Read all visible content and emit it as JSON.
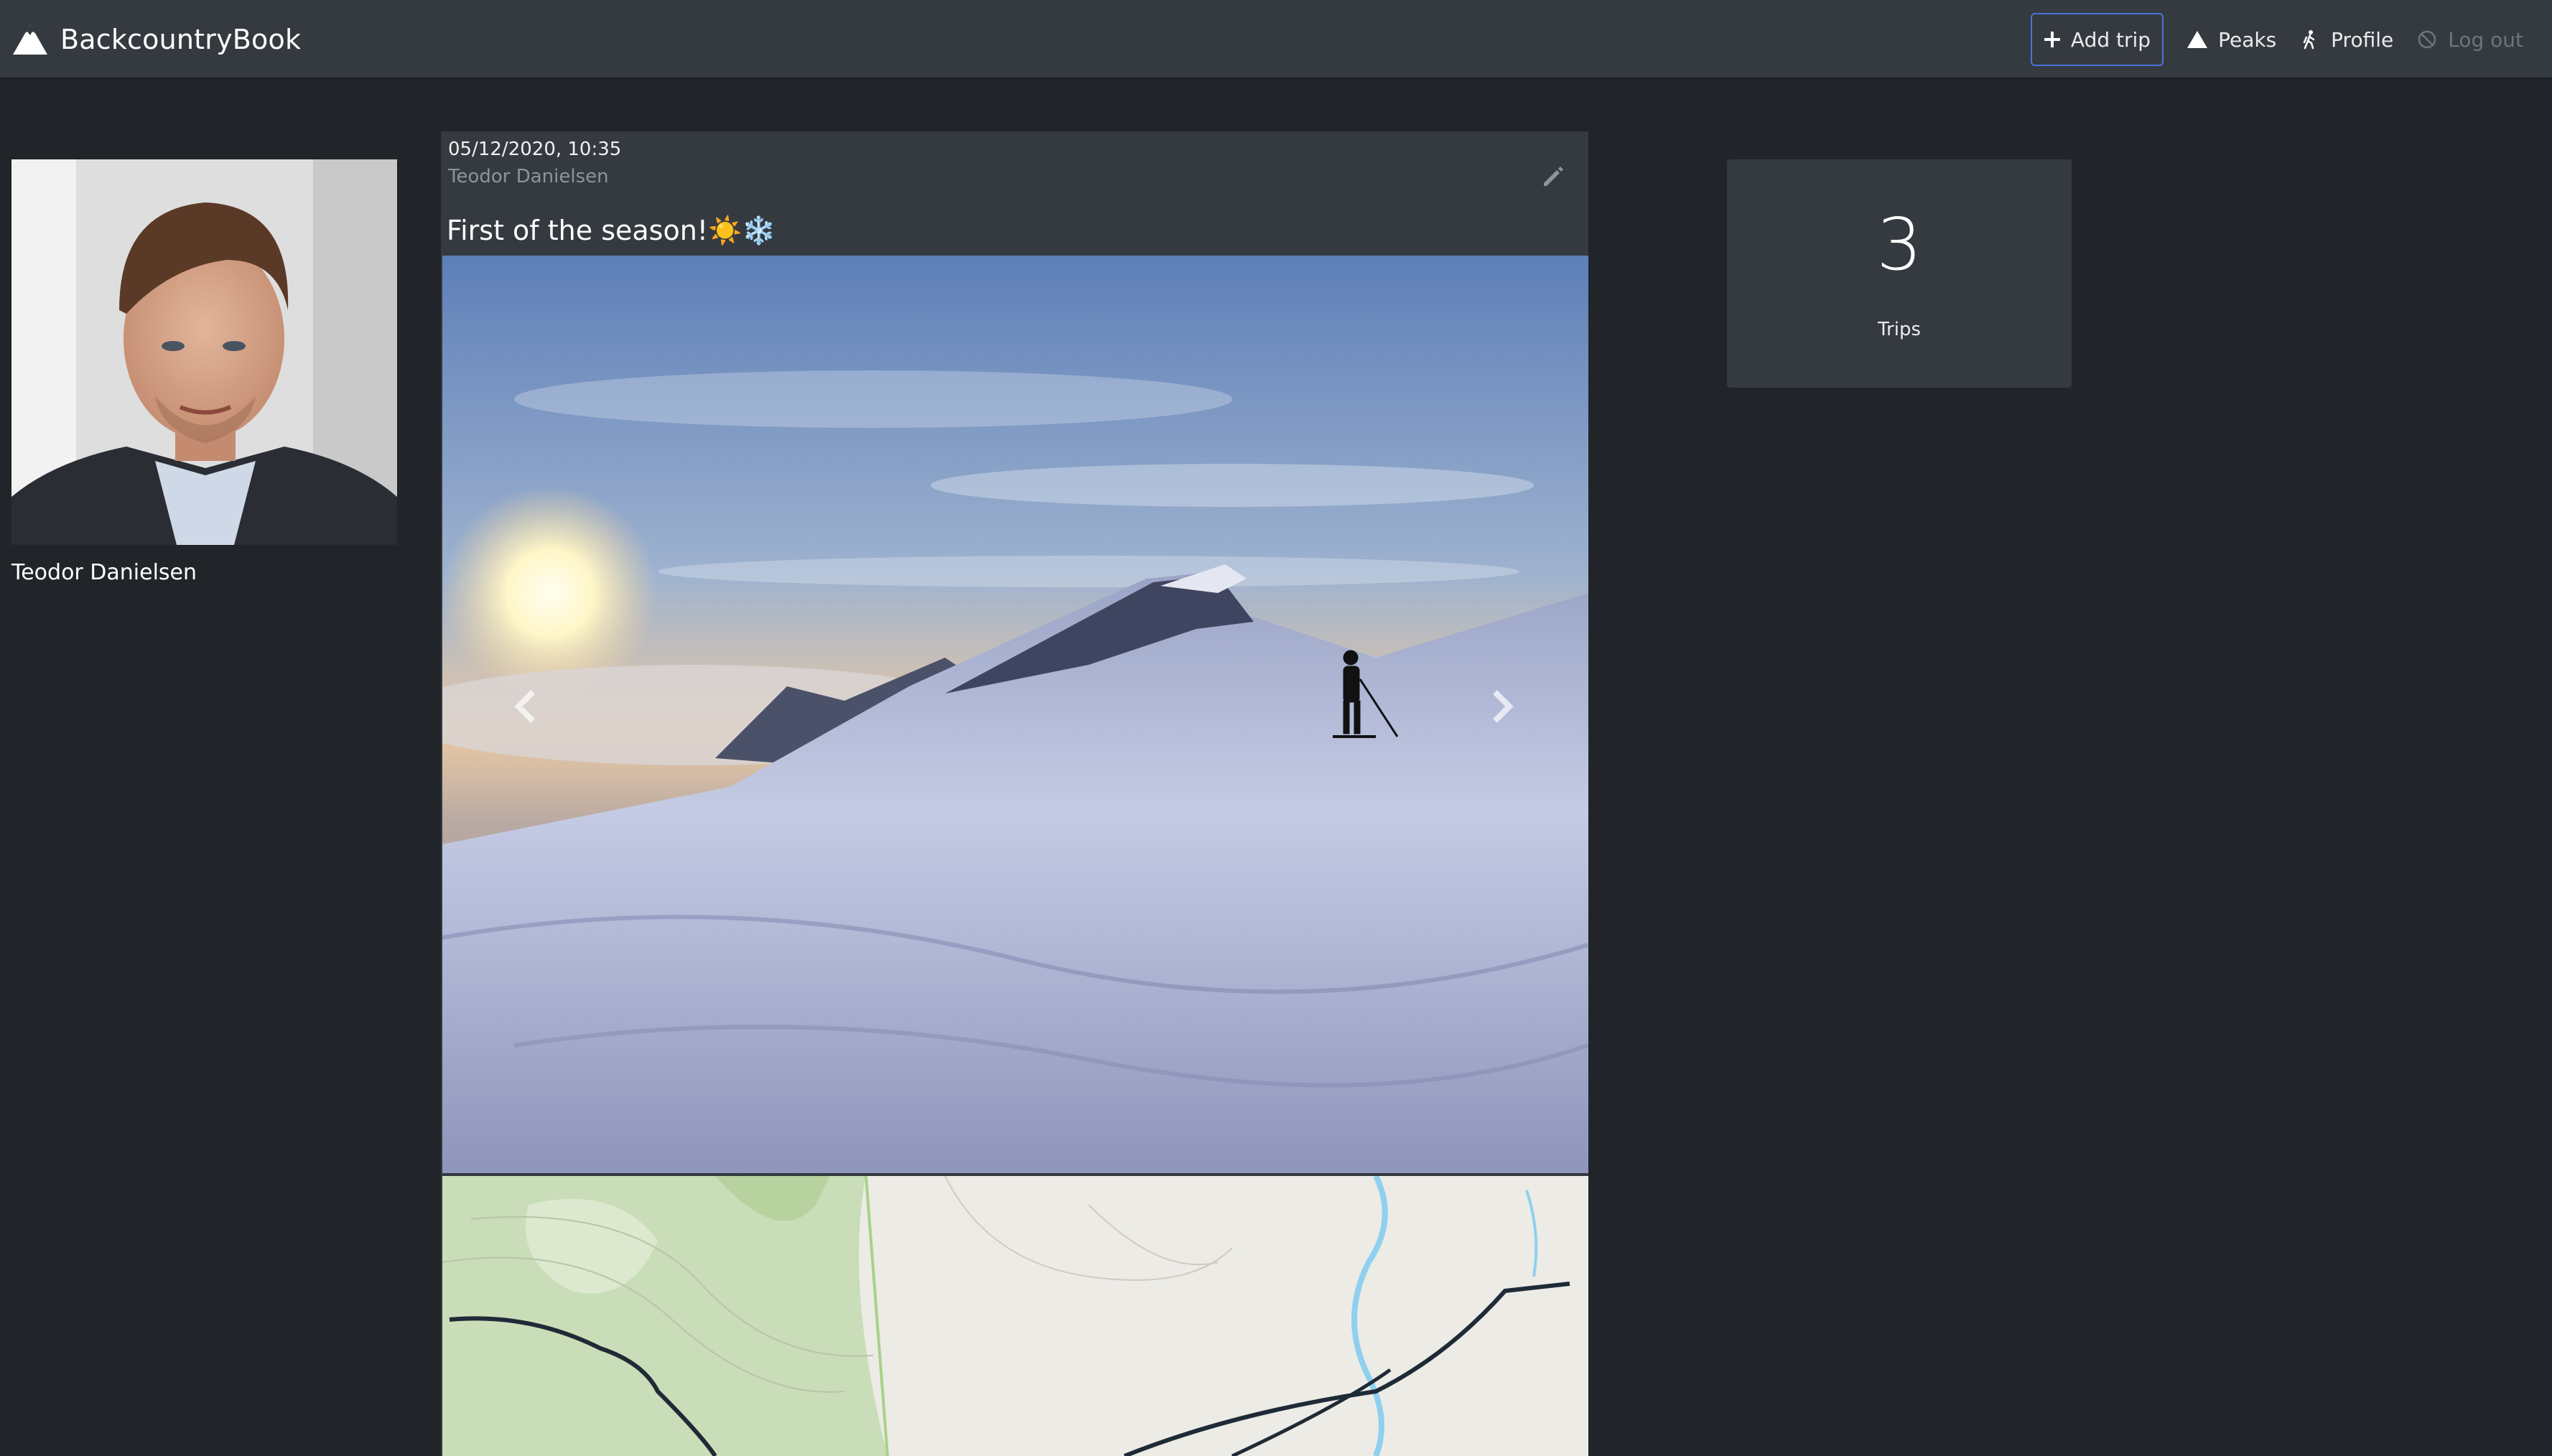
{
  "app": {
    "brand": "BackcountryBook"
  },
  "nav": {
    "add_trip": "Add trip",
    "peaks": "Peaks",
    "profile": "Profile",
    "log_out": "Log out"
  },
  "profile": {
    "name": "Teodor Danielsen"
  },
  "post": {
    "date": "05/12/2020, 10:35",
    "author": "Teodor Danielsen",
    "title": "First of the season!☀️❄️",
    "carousel": {
      "slide_count": 2,
      "active_index": 0
    }
  },
  "stats": {
    "count": "3",
    "label": "Trips"
  },
  "colors": {
    "background": "#212529",
    "navbar": "#343a40",
    "card": "#343a40",
    "accent": "#4b73d6",
    "muted": "#6c757d"
  },
  "icons": {
    "brand": "mountain-icon",
    "add_trip": "plus-icon",
    "peaks": "mountain-icon",
    "profile": "hiker-icon",
    "log_out": "ban-icon",
    "edit": "pencil-icon"
  }
}
